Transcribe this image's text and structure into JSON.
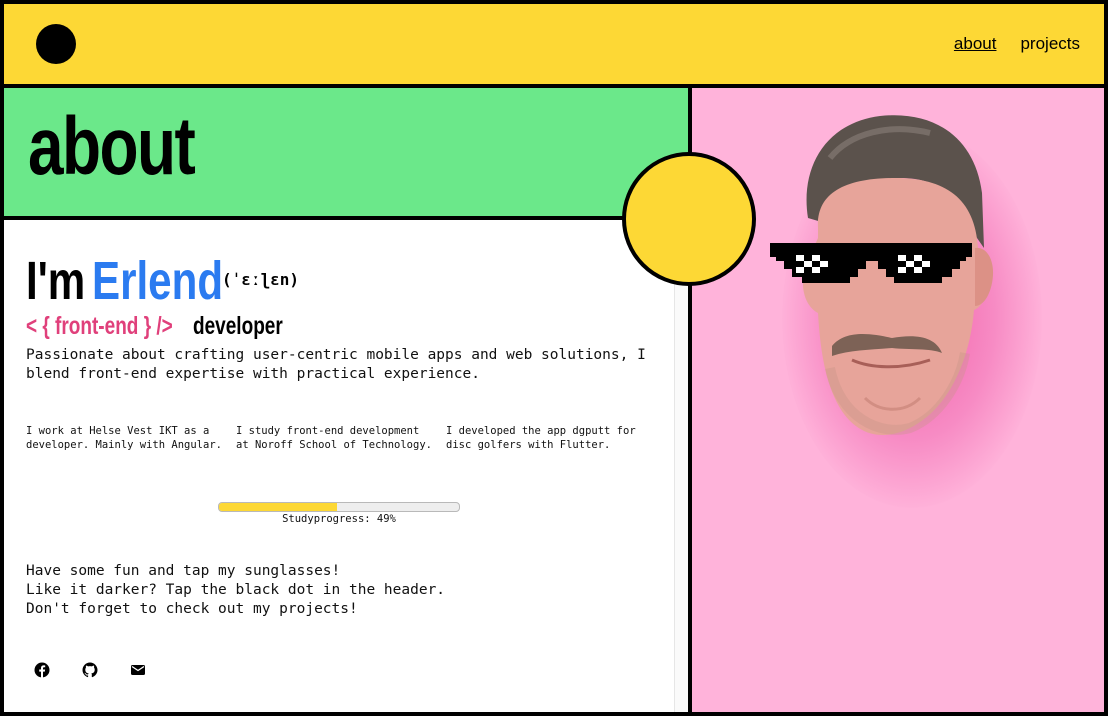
{
  "nav": {
    "about": "about",
    "projects": "projects"
  },
  "hero": {
    "title": "about"
  },
  "intro": {
    "im": "I'm",
    "name": "Erlend",
    "ipa": "(ˈɛːɭɛn)",
    "role_code": "< { front-end } />",
    "role_label": "developer",
    "text": "Passionate about crafting user-centric mobile apps and web solutions, I blend front-end expertise with practical experience."
  },
  "facts": [
    "I work at Helse Vest IKT as a developer. Mainly with Angular.",
    "I study front-end development at Noroff School of Technology.",
    "I developed the app dgputt for disc golfers with Flutter."
  ],
  "progress": {
    "label": "Studyprogress: 49%",
    "value": 0.49
  },
  "fun": {
    "line1": "Have some fun and tap my sunglasses!",
    "line2": "Like it darker? Tap the black dot in the header.",
    "line3": "Don't forget to check out my projects!"
  },
  "social": [
    "facebook-icon",
    "github-icon",
    "mail-icon"
  ],
  "colors": {
    "header": "#FDD835",
    "green": "#6BE88A",
    "pink": "#FFB3DA",
    "name": "#2B7BF0",
    "code": "#E0407B"
  }
}
